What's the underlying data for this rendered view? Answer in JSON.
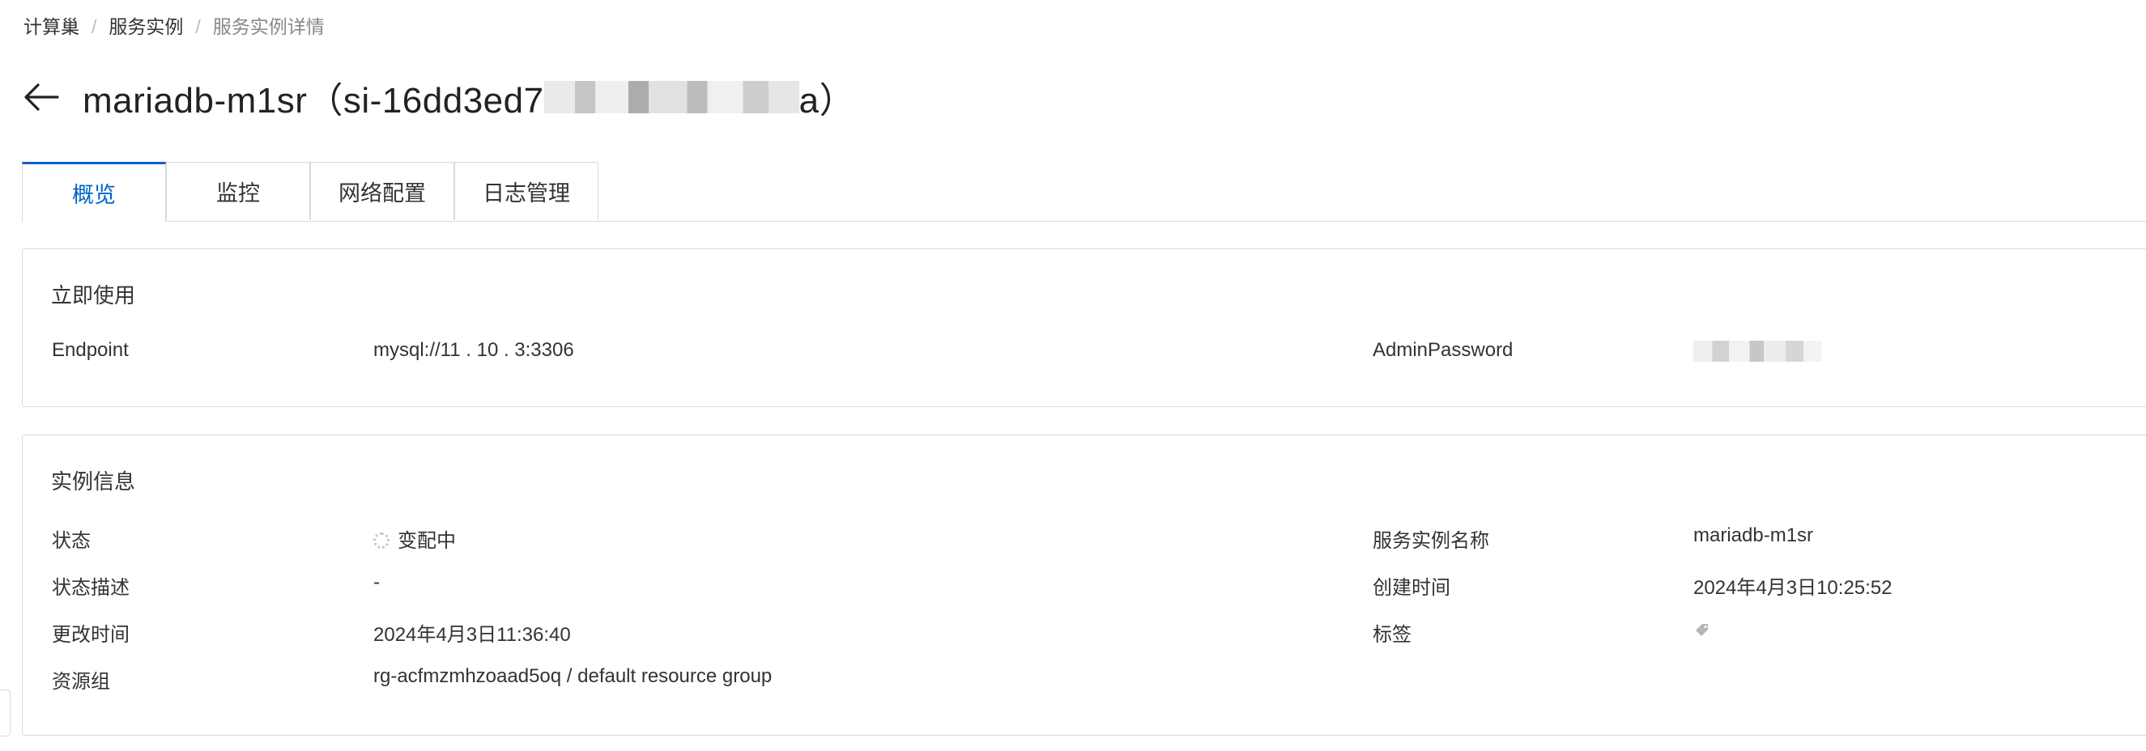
{
  "breadcrumb": {
    "items": [
      "计算巢",
      "服务实例",
      "服务实例详情"
    ],
    "separator": "/"
  },
  "title": {
    "prefix": "mariadb-m1sr（si-16dd3ed7",
    "suffix": "a）",
    "back_icon": "arrow-left-icon"
  },
  "tabs": [
    {
      "label": "概览",
      "active": true
    },
    {
      "label": "监控",
      "active": false
    },
    {
      "label": "网络配置",
      "active": false
    },
    {
      "label": "日志管理",
      "active": false
    }
  ],
  "quick_use": {
    "title": "立即使用",
    "endpoint_label": "Endpoint",
    "endpoint_value": "mysql://11 . 10 . 3:3306",
    "password_label": "AdminPassword"
  },
  "instance_info": {
    "title": "实例信息",
    "status_label": "状态",
    "status_value": "变配中",
    "status_desc_label": "状态描述",
    "status_desc_value": "-",
    "modified_label": "更改时间",
    "modified_value": "2024年4月3日11:36:40",
    "resource_group_label": "资源组",
    "resource_group_value": "rg-acfmzmhzoaad5oq / default resource group",
    "name_label": "服务实例名称",
    "name_value": "mariadb-m1sr",
    "created_label": "创建时间",
    "created_value": "2024年4月3日10:25:52",
    "tags_label": "标签",
    "tags_icon": "edit-tag-icon"
  },
  "colors": {
    "accent": "#0064c8",
    "text": "#333333",
    "muted": "#888888",
    "border": "#d9d9d9"
  }
}
